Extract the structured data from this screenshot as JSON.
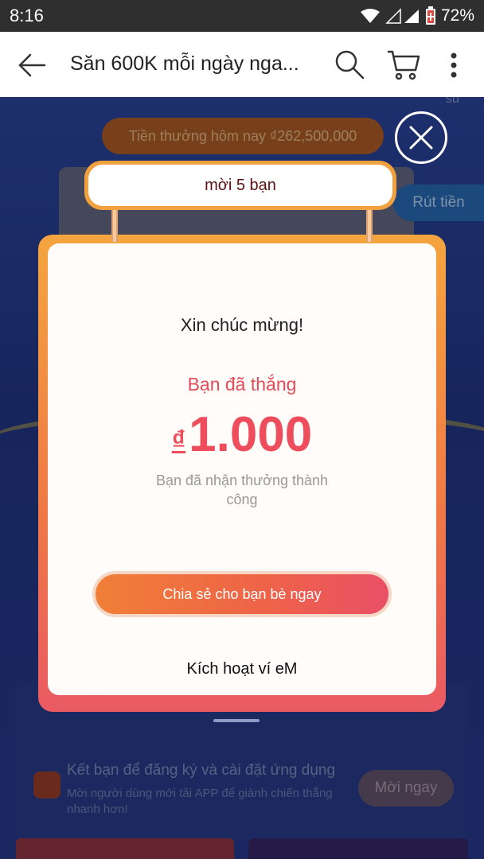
{
  "status_bar": {
    "time": "8:16",
    "battery": "72%"
  },
  "app_bar": {
    "title": "Săn 600K mỗi ngày nga..."
  },
  "background": {
    "top_partial": "su",
    "today_bonus": "Tiền thưởng hôm nay ₫262,500,000",
    "withdraw_button": "Rút tiền",
    "invite": {
      "title": "Kết bạn để đăng ký và cài đặt ứng dụng",
      "subtitle": "Mời người dùng mới tải APP để giành chiến thắng nhanh hơn!",
      "button": "Mời ngay"
    }
  },
  "modal": {
    "header": "mời 5 bạn",
    "congrats": "Xin chúc mừng!",
    "you_won": "Bạn đã thắng",
    "currency_symbol": "₫",
    "amount": "1.000",
    "received_text": "Bạn đã nhận thưởng thành công",
    "share_button": "Chia sẻ cho bạn bè ngay",
    "activate_link": "Kích hoạt ví eM"
  },
  "colors": {
    "accent": "#ee4d5c",
    "frame_orange": "#f4a53e",
    "button_orange": "#f07f37"
  },
  "icons": [
    "back-arrow-icon",
    "search-icon",
    "cart-icon",
    "more-vert-icon",
    "close-icon",
    "wifi-icon",
    "signal-icon",
    "battery-icon"
  ]
}
